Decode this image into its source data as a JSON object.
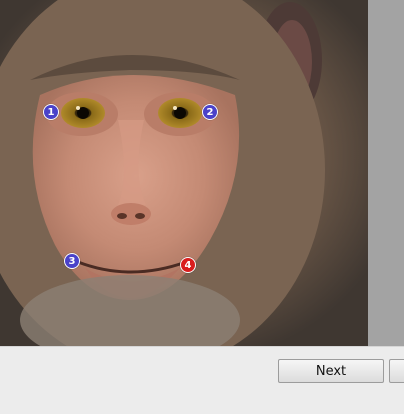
{
  "image": {
    "subject": "monkey-face-photo"
  },
  "landmarks": [
    {
      "label": "1",
      "color": "#4a42c9",
      "kind": "blue"
    },
    {
      "label": "2",
      "color": "#4a42c9",
      "kind": "blue"
    },
    {
      "label": "3",
      "color": "#4a42c9",
      "kind": "blue"
    },
    {
      "label": "4",
      "color": "#d91e1e",
      "kind": "red"
    }
  ],
  "footer": {
    "next_label": "Next",
    "second_label": ""
  },
  "colors": {
    "background": "#ececec",
    "strip": "#a3a3a3",
    "accent_blue": "#4a42c9",
    "accent_red": "#d91e1e"
  }
}
